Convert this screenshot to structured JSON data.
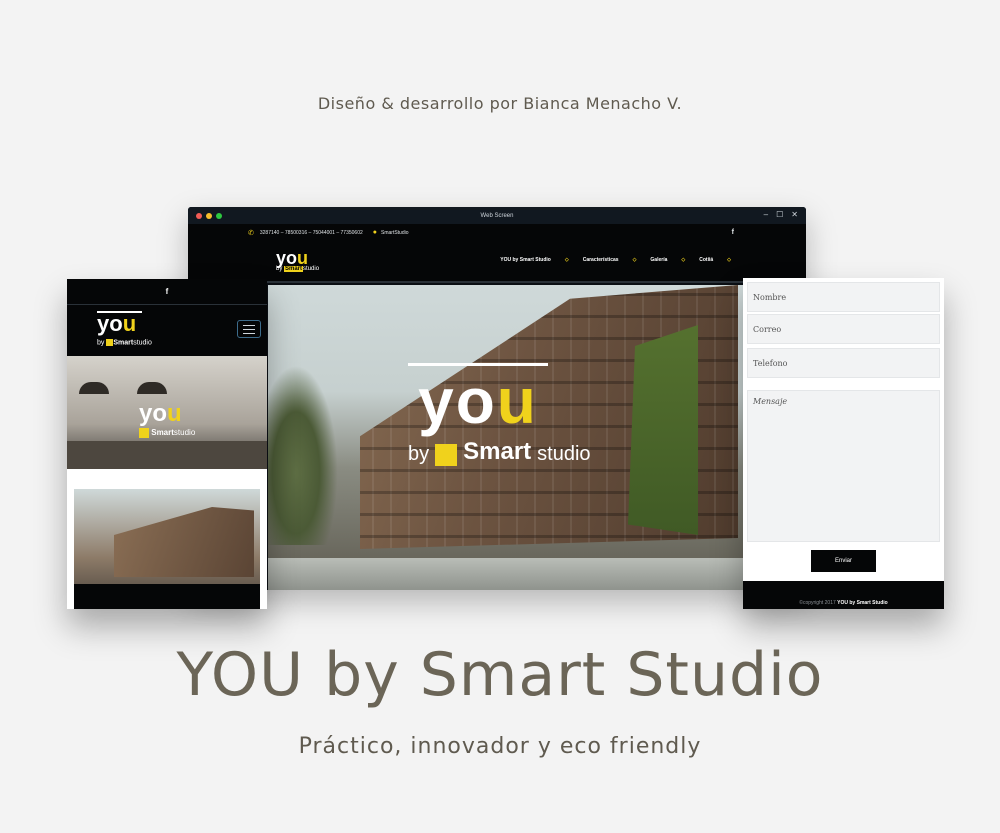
{
  "credit": "Diseño & desarrollo por Bianca Menacho V.",
  "title": "YOU by Smart Studio",
  "subtitle": "Práctico, innovador y eco friendly",
  "window": {
    "title": "Web Screen",
    "colors": {
      "close": "#f15b55",
      "minimize": "#f7bd2b",
      "maximize": "#2ec840",
      "accent": "#f0d21c"
    }
  },
  "topbar": {
    "phones": "3287140 – 78500316 – 75044001 – 77350602",
    "skype": "SmartStudio",
    "facebook": "f"
  },
  "logo": {
    "you_prefix": "yo",
    "you_suffix": "u",
    "by": "by",
    "smart": "Smart",
    "studio": "studio"
  },
  "nav": [
    "YOU by Smart Studio",
    "Características",
    "Galería",
    "Cotiiá"
  ],
  "nav_sep": "◇",
  "mobile": {
    "facebook": "f"
  },
  "form": {
    "name": "Nombre",
    "email": "Correo",
    "phone": "Telefono",
    "message": "Mensaje",
    "submit": "Enviar",
    "footer_prefix": "©copyright 2017",
    "footer_brand": "YOU by Smart Studio"
  }
}
